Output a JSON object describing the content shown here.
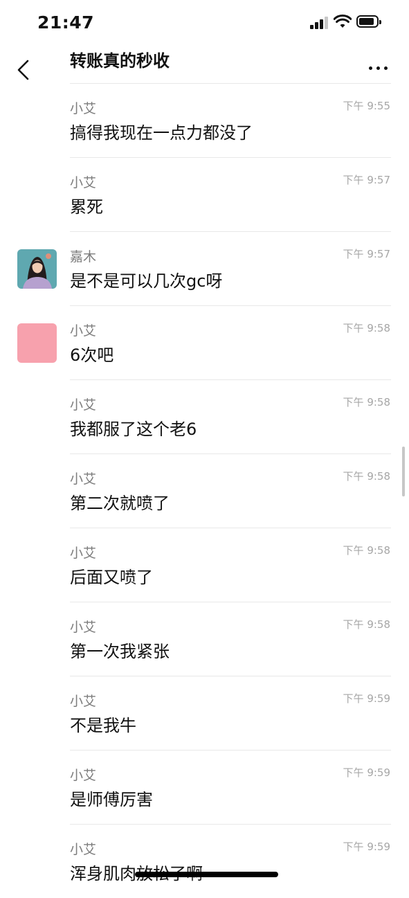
{
  "status": {
    "time": "21:47"
  },
  "header": {
    "title": "转账真的秒收"
  },
  "messages": [
    {
      "name": "小艾",
      "time": "下午 9:55",
      "text": "搞得我现在一点力都没了"
    },
    {
      "name": "小艾",
      "time": "下午 9:57",
      "text": "累死"
    },
    {
      "name": "嘉木",
      "time": "下午 9:57",
      "text": "是不是可以几次gc呀"
    },
    {
      "name": "小艾",
      "time": "下午 9:58",
      "text": "6次吧"
    },
    {
      "name": "小艾",
      "time": "下午 9:58",
      "text": "我都服了这个老6"
    },
    {
      "name": "小艾",
      "time": "下午 9:58",
      "text": "第二次就喷了"
    },
    {
      "name": "小艾",
      "time": "下午 9:58",
      "text": "后面又喷了"
    },
    {
      "name": "小艾",
      "time": "下午 9:58",
      "text": "第一次我紧张"
    },
    {
      "name": "小艾",
      "time": "下午 9:59",
      "text": "不是我牛"
    },
    {
      "name": "小艾",
      "time": "下午 9:59",
      "text": "是师傅厉害"
    },
    {
      "name": "小艾",
      "time": "下午 9:59",
      "text": "浑身肌肉放松了啊"
    }
  ],
  "colors": {
    "pink_avatar": "#f7a1ad",
    "name_gray": "#7c7c7c",
    "time_gray": "#a6a6a6",
    "divider": "#e8e8e8"
  }
}
